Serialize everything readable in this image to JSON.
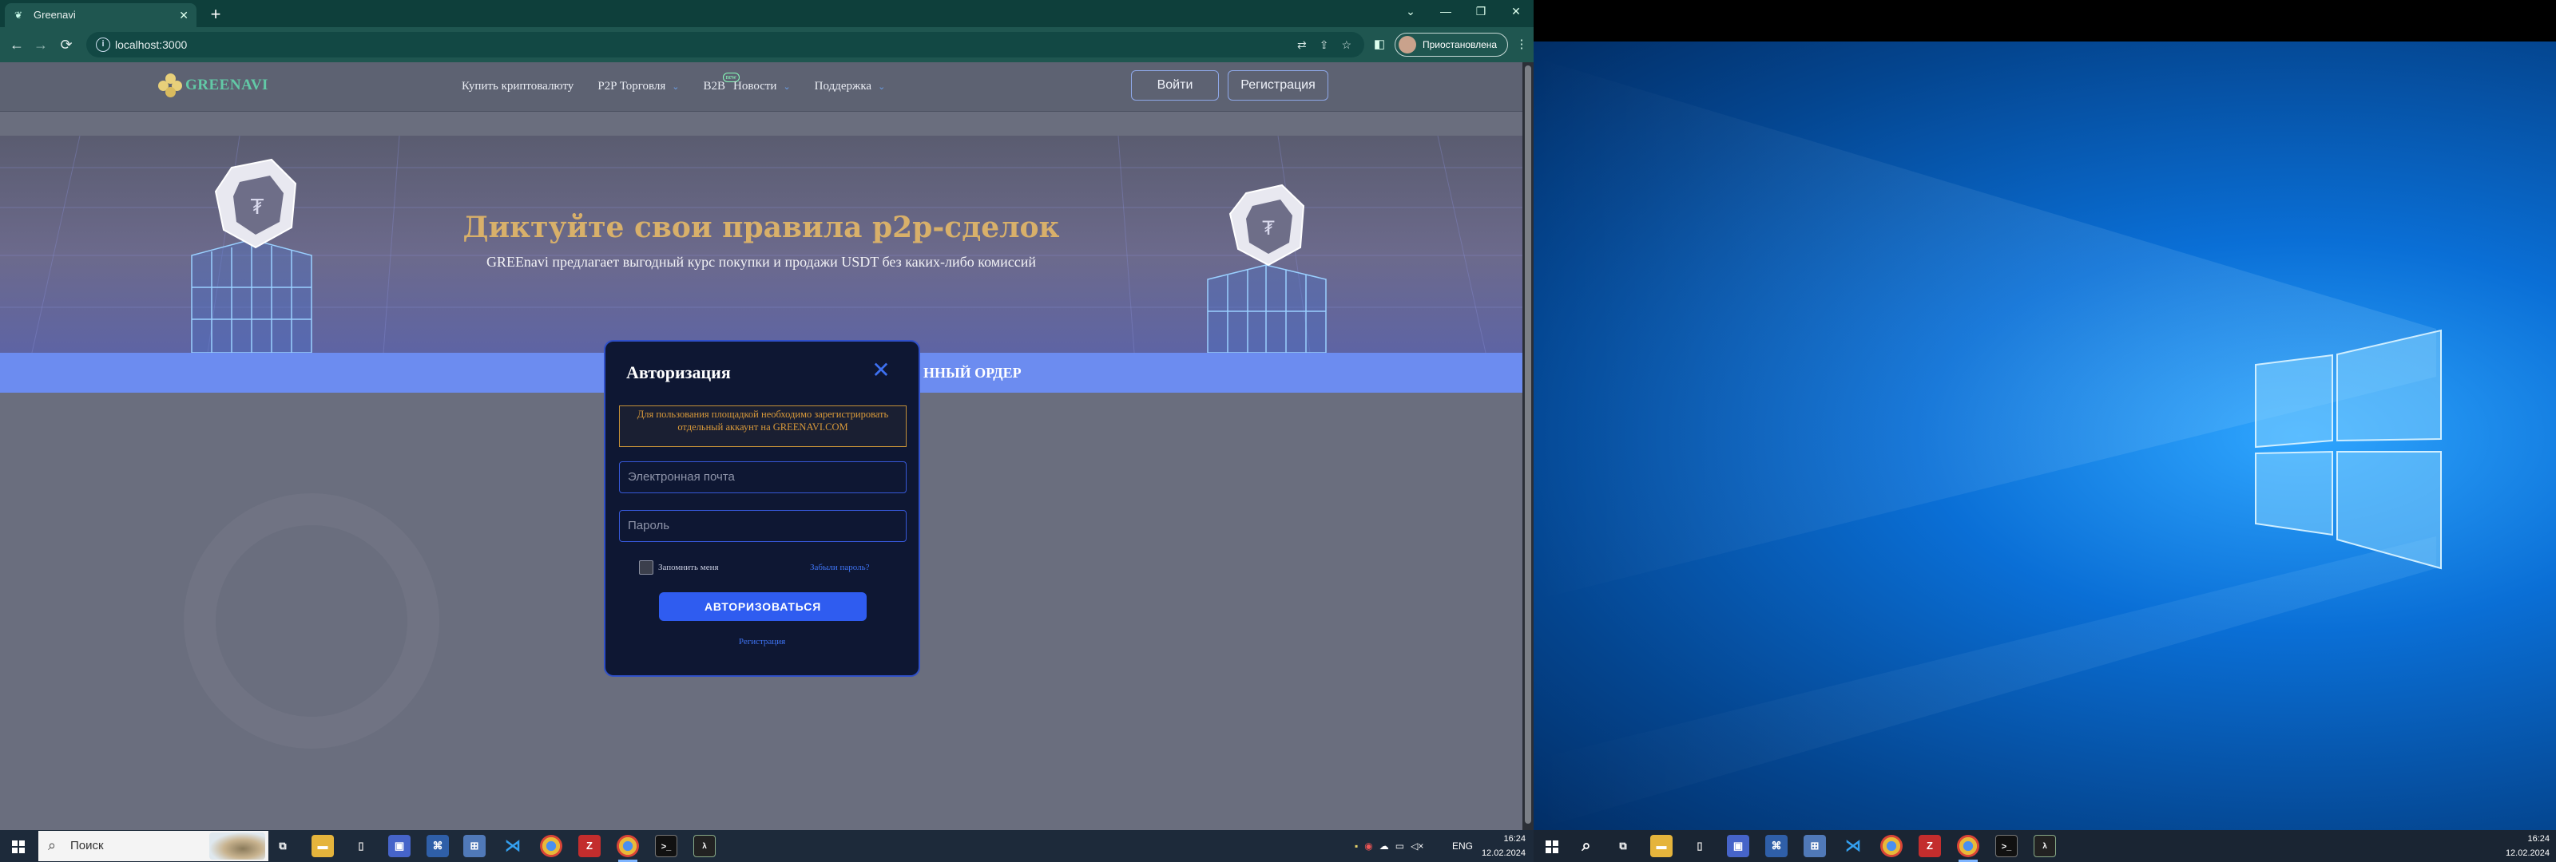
{
  "browser": {
    "tab_title": "Greenavi",
    "tab_close": "✕",
    "new_tab": "+",
    "url": "localhost:3000",
    "profile_label": "Приостановлена",
    "window_controls": [
      "⌄",
      "—",
      "❐",
      "✕"
    ]
  },
  "site": {
    "logo_text": "GREENAVI",
    "nav": [
      {
        "label": "Купить криптовалюту",
        "has_chevron": false
      },
      {
        "label": "P2P Торговля",
        "has_chevron": true
      },
      {
        "label": "B2B",
        "has_chevron": false,
        "badge": "new"
      },
      {
        "label": "Новости",
        "has_chevron": true
      },
      {
        "label": "Поддержка",
        "has_chevron": true
      }
    ],
    "login_label": "Войти",
    "register_label": "Регистрация",
    "hero_title": "Диктуйте свои правила p2p-сделок",
    "hero_subtitle": "GREEnavi предлагает выгодный курс покупки и продажи USDT без каких-либо комиссий",
    "order_bar_text": "ННЫЙ ОРДЕР"
  },
  "modal": {
    "title": "Авторизация",
    "close_glyph": "✕",
    "warning": "Для пользования площадкой необходимо зарегистрировать отдельный аккаунт на GREENAVI.COM",
    "email_placeholder": "Электронная почта",
    "password_placeholder": "Пароль",
    "remember_label": "Запомнить меня",
    "forgot_label": "Забыли пароль?",
    "submit_label": "АВТОРИЗОВАТЬСЯ",
    "register_link": "Регистрация"
  },
  "taskbar1": {
    "search_placeholder": "Поиск",
    "apps": [
      "task-view",
      "file-explorer",
      "notepad",
      "floppy-app",
      "network-app",
      "remote-app",
      "vscode",
      "chrome",
      "filezilla",
      "chrome-active",
      "terminal",
      "wsl-terminal"
    ],
    "lang": "ENG",
    "time": "16:24",
    "date": "12.02.2024"
  },
  "taskbar2": {
    "time": "16:24",
    "date": "12.02.2024"
  },
  "colors": {
    "accent": "#2f5cf0",
    "brand_green": "#62c9a6",
    "hero_gold": "#d8b06a",
    "warning": "#d99a3a",
    "desktop_blue": "#0a6fd6"
  }
}
